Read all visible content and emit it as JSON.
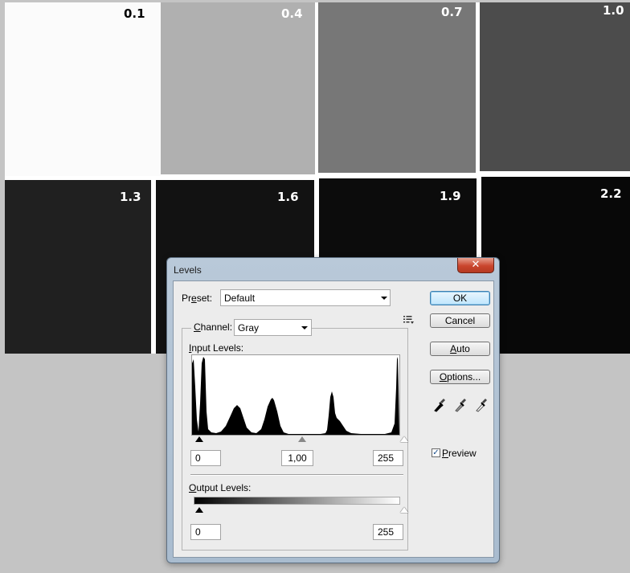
{
  "background_image": {
    "patch_labels": [
      "0.1",
      "0.4",
      "0.7",
      "1.0",
      "1.3",
      "1.6",
      "1.9",
      "2.2"
    ]
  },
  "dialog": {
    "title": "Levels",
    "close_glyph": "✕",
    "preset_label": "Preset:",
    "preset_value": "Default",
    "channel_label": "Channel:",
    "channel_value": "Gray",
    "input_levels_label": "Input Levels:",
    "input_black": "0",
    "input_gamma": "1,00",
    "input_white": "255",
    "output_levels_label": "Output Levels:",
    "output_black": "0",
    "output_white": "255",
    "buttons": {
      "ok": "OK",
      "cancel": "Cancel",
      "auto": "Auto",
      "options": "Options..."
    },
    "preview_label": "Preview",
    "preview_checked": true,
    "check_glyph": "✓"
  },
  "icons": [
    "close-icon",
    "preset-menu-icon",
    "dropdown-caret-icon",
    "black-eyedropper-icon",
    "gray-eyedropper-icon",
    "white-eyedropper-icon"
  ]
}
